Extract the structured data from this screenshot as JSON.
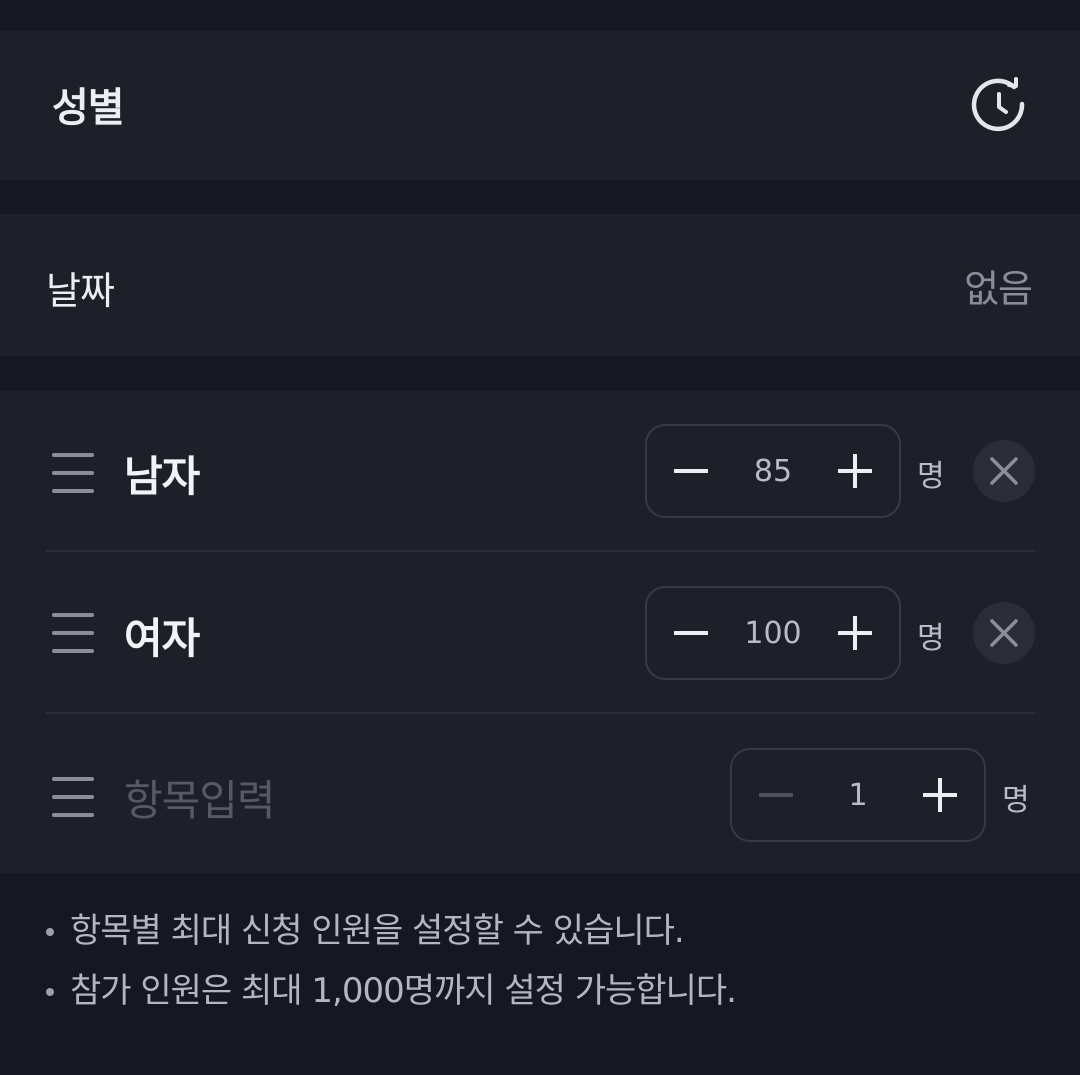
{
  "header": {
    "title": "성별",
    "history_icon": "history-icon"
  },
  "date": {
    "label": "날짜",
    "value": "없음"
  },
  "items": [
    {
      "label": "남자",
      "value": "85",
      "unit": "명"
    },
    {
      "label": "여자",
      "value": "100",
      "unit": "명"
    }
  ],
  "new_item": {
    "placeholder": "항목입력",
    "value": "1",
    "unit": "명"
  },
  "notes": [
    "항목별 최대 신청 인원을 설정할 수 있습니다.",
    "참가 인원은 최대 1,000명까지 설정 가능합니다."
  ],
  "colors": {
    "background": "#151820",
    "panel": "#1e2029",
    "accent_text": "#eceef3"
  }
}
